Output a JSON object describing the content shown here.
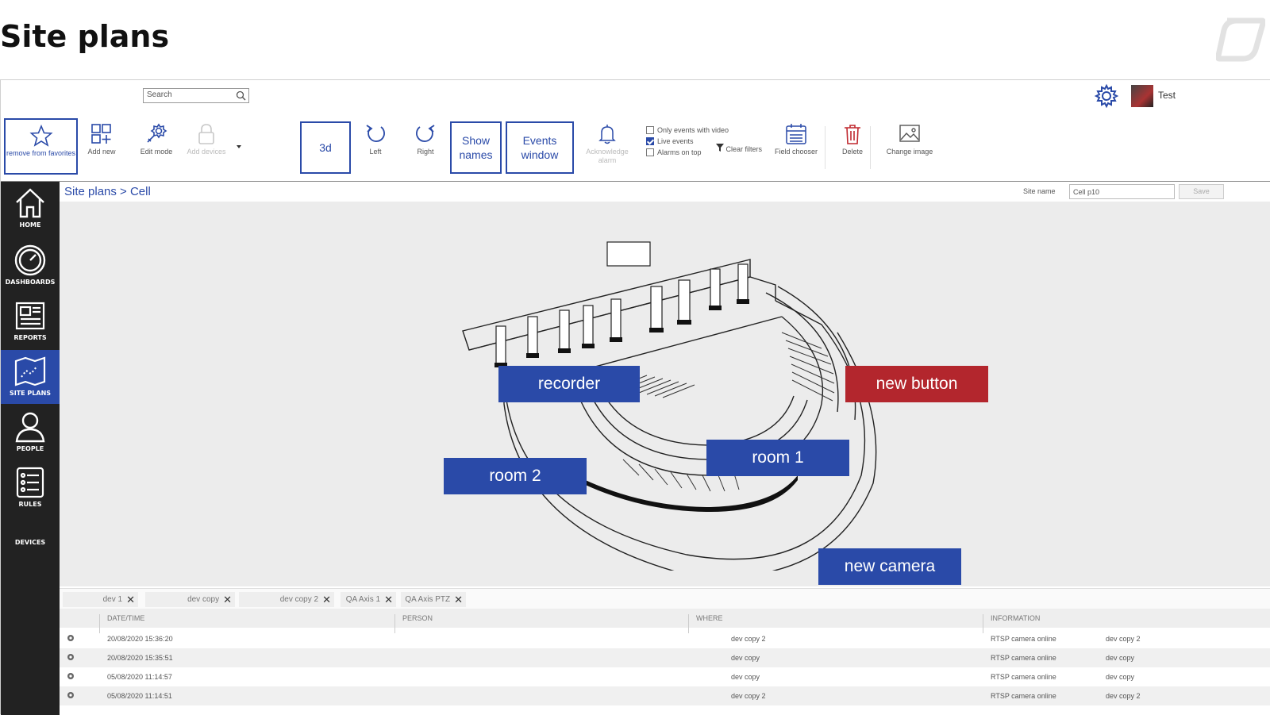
{
  "slide": {
    "title": "Site plans"
  },
  "topbar": {
    "search_placeholder": "Search",
    "user_name": "Test"
  },
  "toolbar": {
    "remove_favorites": "remove from favorites",
    "add_new": "Add new",
    "edit_mode": "Edit mode",
    "add_devices": "Add devices",
    "view_3d": "3d",
    "rotate_left": "Left",
    "rotate_right": "Right",
    "show_names": "Show names",
    "events_window": "Events window",
    "acknowledge_alarm": "Acknowledge alarm",
    "only_events_with_video": "Only events with video",
    "live_events": "Live events",
    "alarms_on_top": "Alarms on top",
    "clear_filters": "Clear filters",
    "field_chooser": "Field chooser",
    "delete": "Delete",
    "change_image": "Change image",
    "live_events_checked": true,
    "only_events_checked": false,
    "alarms_on_top_checked": false
  },
  "sidebar": {
    "items": [
      {
        "label": "HOME",
        "icon": "home-icon",
        "active": false
      },
      {
        "label": "DASHBOARDS",
        "icon": "gauge-icon",
        "active": false
      },
      {
        "label": "REPORTS",
        "icon": "report-icon",
        "active": false
      },
      {
        "label": "SITE PLANS",
        "icon": "map-icon",
        "active": true
      },
      {
        "label": "PEOPLE",
        "icon": "person-icon",
        "active": false
      },
      {
        "label": "RULES",
        "icon": "list-icon",
        "active": false
      },
      {
        "label": "DEVICES",
        "icon": "",
        "active": false
      }
    ]
  },
  "content": {
    "breadcrumb": "Site plans > Cell",
    "site_name_label": "Site name",
    "site_name_value": "Cell p10",
    "save_label": "Save"
  },
  "markers": {
    "recorder": "recorder",
    "new_button": "new button",
    "room1": "room 1",
    "room2": "room 2",
    "new_camera": "new camera"
  },
  "colors": {
    "accent": "#2a4aa8",
    "alarm": "#b3262d",
    "sidebar": "#222222"
  },
  "events": {
    "filter_chips": [
      "dev 1",
      "dev copy",
      "dev copy 2",
      "QA Axis 1",
      "QA Axis PTZ"
    ],
    "columns": [
      "DATE/TIME",
      "PERSON",
      "WHERE",
      "INFORMATION"
    ],
    "rows": [
      {
        "datetime": "20/08/2020 15:36:20",
        "person": "",
        "where": "dev copy 2",
        "info": "RTSP camera online",
        "device": "dev copy 2"
      },
      {
        "datetime": "20/08/2020 15:35:51",
        "person": "",
        "where": "dev copy",
        "info": "RTSP camera online",
        "device": "dev copy"
      },
      {
        "datetime": "05/08/2020 11:14:57",
        "person": "",
        "where": "dev copy",
        "info": "RTSP camera online",
        "device": "dev copy"
      },
      {
        "datetime": "05/08/2020 11:14:51",
        "person": "",
        "where": "dev copy 2",
        "info": "RTSP camera online",
        "device": "dev copy 2"
      }
    ]
  }
}
